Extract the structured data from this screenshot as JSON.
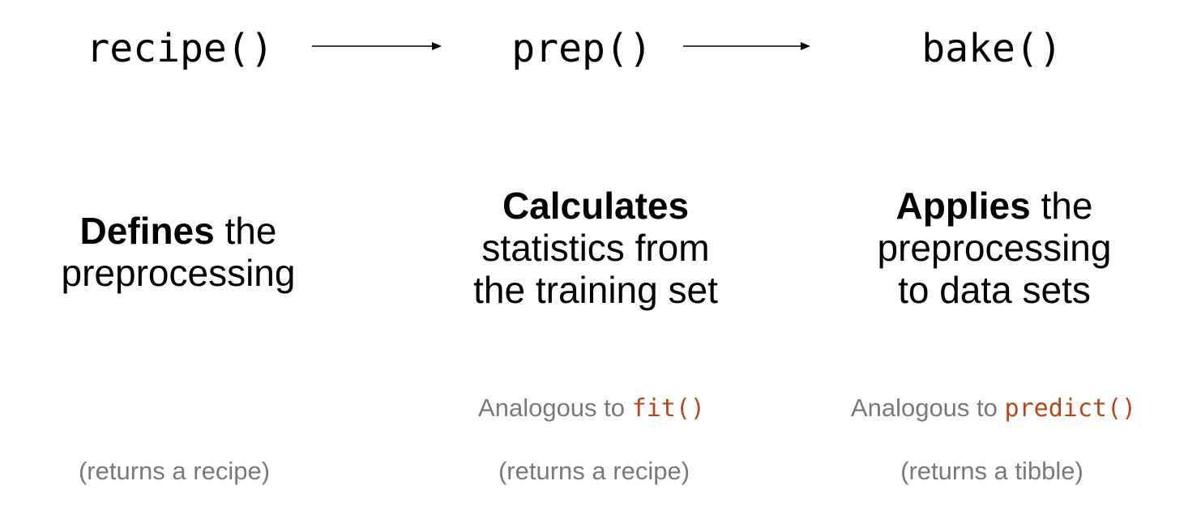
{
  "steps": [
    {
      "function": "recipe()",
      "desc_bold": "Defines",
      "desc_line1_rest": "the",
      "desc_line2": "preprocessing",
      "returns": "(returns a recipe)"
    },
    {
      "function": "prep()",
      "desc_bold": "Calculates",
      "desc_line2": "statistics from",
      "desc_line3": "the training set",
      "analogous_prefix": "Analogous to",
      "analogous_code": "fit()",
      "returns": "(returns a recipe)"
    },
    {
      "function": "bake()",
      "desc_bold": "Applies",
      "desc_line1_rest": "the",
      "desc_line2": "preprocessing",
      "desc_line3": "to data sets",
      "analogous_prefix": "Analogous to",
      "analogous_code": "predict()",
      "returns": "(returns a tibble)"
    }
  ],
  "colors": {
    "code_accent": "#b5471b",
    "secondary_text": "#7a7a7a"
  }
}
